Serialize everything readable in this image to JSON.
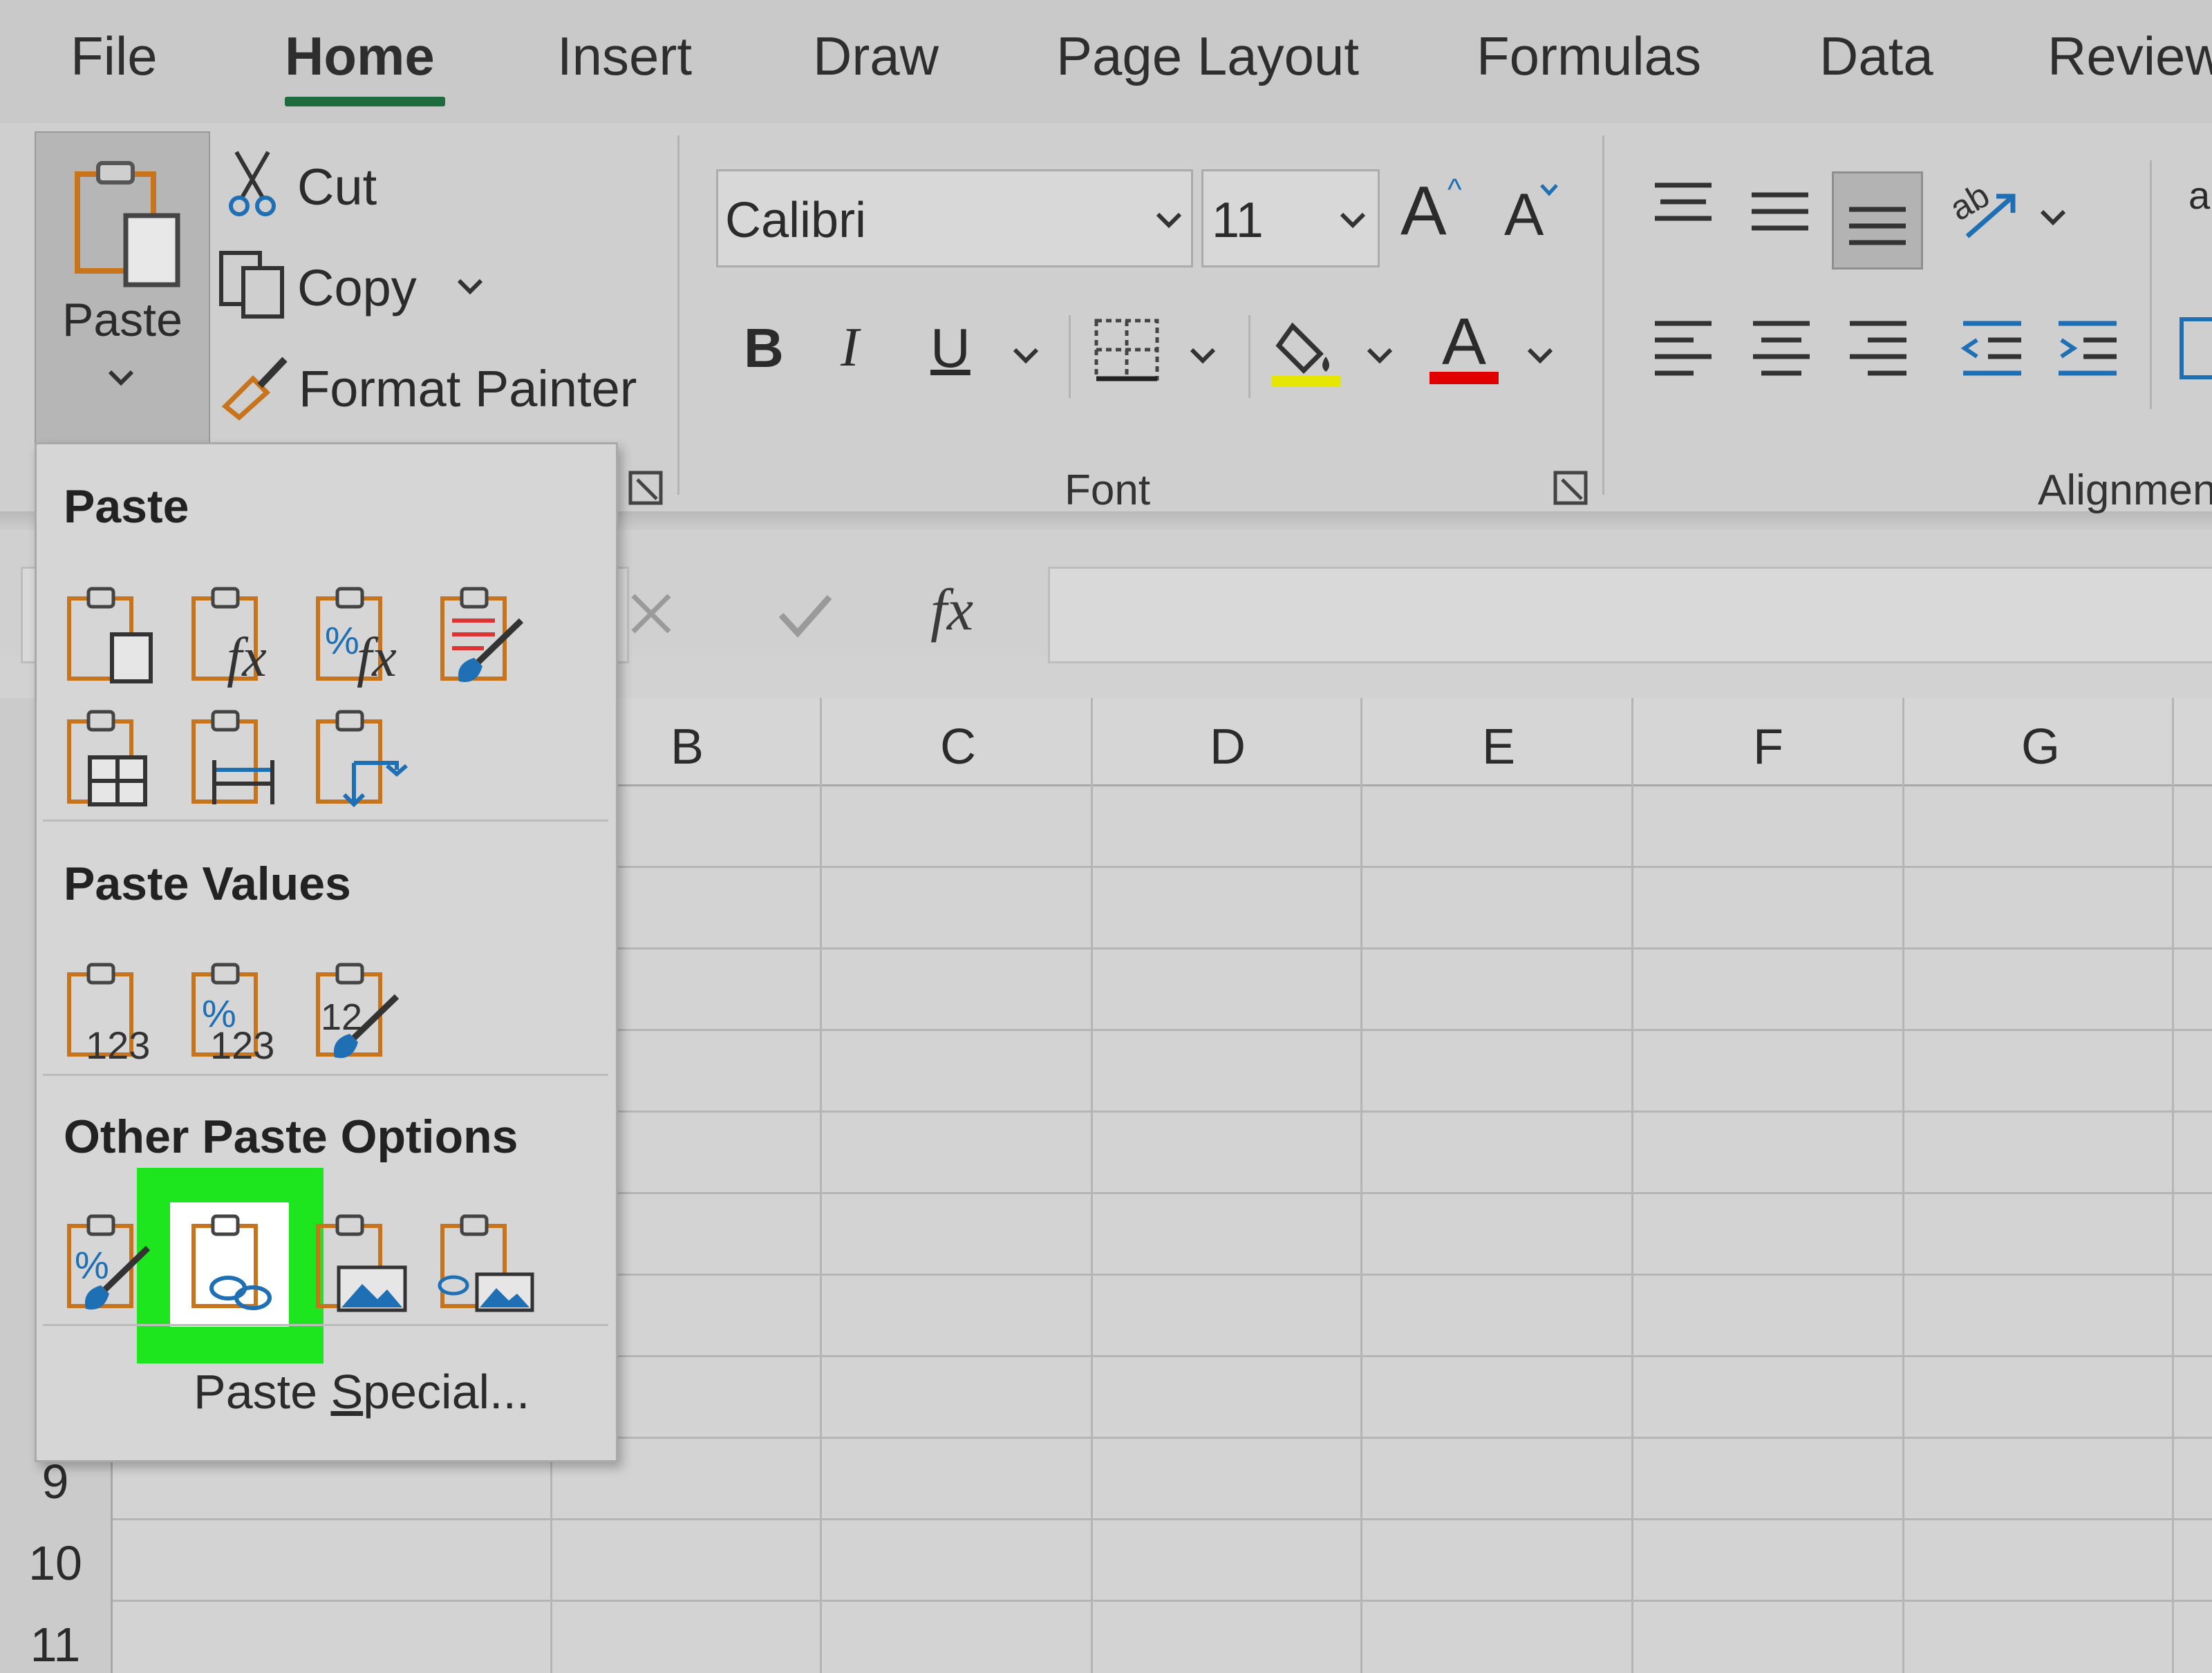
{
  "tabs": [
    "File",
    "Home",
    "Insert",
    "Draw",
    "Page Layout",
    "Formulas",
    "Data",
    "Review"
  ],
  "active_tab": "Home",
  "clipboard": {
    "paste_label": "Paste",
    "cut_label": "Cut",
    "copy_label": "Copy",
    "format_painter_label": "Format Painter"
  },
  "font": {
    "font_name": "Calibri",
    "font_size": "11",
    "group_label": "Font",
    "bold": "B",
    "italic": "I",
    "underline": "U",
    "grow_font": "A",
    "shrink_font": "A",
    "font_color_glyph": "A",
    "highlight_color": "#e6e600",
    "font_color": "#e00000"
  },
  "alignment": {
    "group_label": "Alignmen",
    "wrap_text_partial": "a"
  },
  "formula_bar": {
    "fx_label": "fx",
    "value": ""
  },
  "columns": [
    "B",
    "C",
    "D",
    "E",
    "F",
    "G"
  ],
  "rows": [
    "9",
    "10",
    "11"
  ],
  "paste_menu": {
    "paste_header": "Paste",
    "paste_values_header": "Paste Values",
    "other_options_header": "Other Paste Options",
    "paste_special_prefix": "Paste ",
    "paste_special_underlined": "S",
    "paste_special_suffix": "pecial...",
    "paste_icons": [
      "paste-icon",
      "paste-formulas-icon",
      "paste-formulas-number-formatting-icon",
      "keep-source-formatting-icon",
      "no-borders-icon",
      "keep-source-column-widths-icon",
      "transpose-icon"
    ],
    "paste_values_icons": [
      "values-icon",
      "values-number-formatting-icon",
      "values-source-formatting-icon"
    ],
    "other_icons": [
      "formatting-icon",
      "paste-link-icon",
      "picture-icon",
      "linked-picture-icon"
    ],
    "value_label_123": "123",
    "percent_glyph": "%",
    "highlighted_option": "paste-link-icon",
    "highlight_color": "#1ee61e"
  }
}
